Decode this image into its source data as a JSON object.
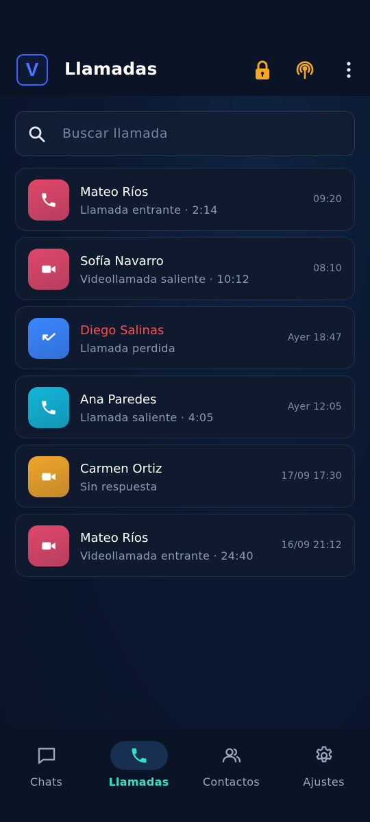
{
  "header": {
    "logo_letter": "V",
    "title": "Llamadas",
    "icons": [
      "lock-icon",
      "broadcast-icon",
      "more-vertical-icon"
    ]
  },
  "search": {
    "placeholder": "Buscar llamada",
    "value": ""
  },
  "calls": [
    {
      "name": "Mateo Ríos",
      "detail": "Llamada entrante · 2:14",
      "time": "09:20",
      "type": "phone-icon",
      "color": "#e0476a",
      "missed": false
    },
    {
      "name": "Sofía Navarro",
      "detail": "Videollamada saliente · 10:12",
      "time": "08:10",
      "type": "video-icon",
      "color": "#e0476a",
      "missed": false
    },
    {
      "name": "Diego Salinas",
      "detail": "Llamada perdida",
      "time": "Ayer 18:47",
      "type": "missed-call-icon",
      "color": "#3a86ff",
      "missed": true
    },
    {
      "name": "Ana Paredes",
      "detail": "Llamada saliente · 4:05",
      "time": "Ayer 12:05",
      "type": "phone-icon",
      "color": "#13b5d8",
      "missed": false
    },
    {
      "name": "Carmen Ortiz",
      "detail": "Sin respuesta",
      "time": "17/09 17:30",
      "type": "video-icon",
      "color": "#f0a52a",
      "missed": false
    },
    {
      "name": "Mateo Ríos",
      "detail": "Videollamada entrante · 24:40",
      "time": "16/09 21:12",
      "type": "video-icon",
      "color": "#e0476a",
      "missed": false
    }
  ],
  "nav": {
    "items": [
      {
        "label": "Chats",
        "icon": "chat-icon",
        "active": false
      },
      {
        "label": "Llamadas",
        "icon": "phone-icon",
        "active": true
      },
      {
        "label": "Contactos",
        "icon": "contacts-icon",
        "active": false
      },
      {
        "label": "Ajustes",
        "icon": "gear-icon",
        "active": false
      }
    ]
  },
  "colors": {
    "accent": "#2ee0c6",
    "brand": "#3d63ff",
    "missed": "#ff4d4d",
    "warning": "#f5a623"
  }
}
